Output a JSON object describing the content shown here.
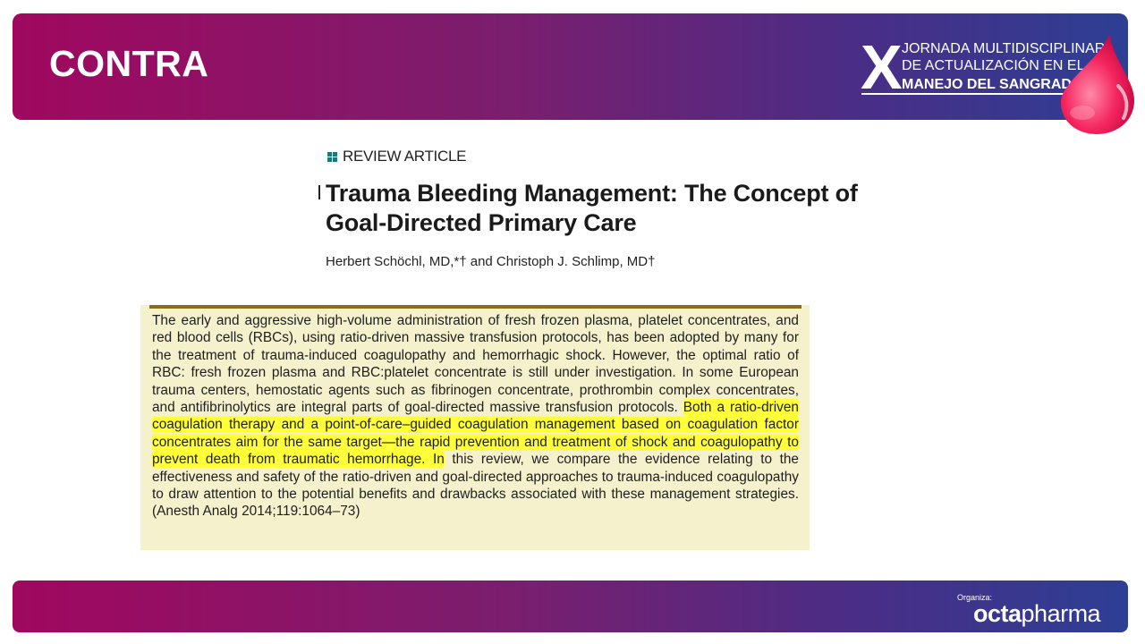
{
  "slide": {
    "title": "CONTRA"
  },
  "event_logo": {
    "numeral": "X",
    "line1": "JORNADA MULTIDISCIPLINAR",
    "line2": "DE ACTUALIZACIÓN EN EL",
    "line3": "MANEJO DEL SANGRADO"
  },
  "article": {
    "section_label": "REVIEW ARTICLE",
    "title": "Trauma Bleeding Management: The Concept of Goal-Directed Primary Care",
    "authors": "Herbert Schöchl, MD,*† and Christoph J. Schlimp, MD†"
  },
  "abstract": {
    "before_highlight": "The early and aggressive high-volume administration of fresh frozen plasma, platelet concentrates, and red blood cells (RBCs), using ratio-driven massive transfusion protocols, has been adopted by many for the treatment of trauma-induced coagulopathy and hemorrhagic shock. However, the optimal ratio of RBC: fresh frozen plasma and RBC:platelet concentrate is still under investigation. In some European trauma centers, hemostatic agents such as fibrinogen concentrate, prothrombin complex concentrates, and antifibrinolytics are integral parts of goal-directed massive transfusion protocols. ",
    "highlight": "Both a ratio-driven coagulation therapy and a point-of-care–guided coagulation management based on coagulation factor concentrates aim for the same target—the rapid prevention and treatment of shock and coagulopathy to prevent death from traumatic hemorrhage. In",
    "after_highlight": " this review, we compare the evidence relating to the effectiveness and safety of the ratio-driven and goal-directed approaches to trauma-induced coagulopathy to draw attention to the potential benefits and drawbacks associated with these management strategies.  (Anesth Analg 2014;119:1064–73)",
    "highlight_color": "#ffff3a",
    "background_color": "#f6f1cd"
  },
  "footer": {
    "organiza_label": "Organiza:",
    "sponsor_bold": "octa",
    "sponsor_regular": "pharma"
  },
  "colors": {
    "gradient_start": "#a0085f",
    "gradient_end": "#2d3f94",
    "review_icon": "#1b7a78",
    "abstract_rule": "#8b6d14"
  }
}
